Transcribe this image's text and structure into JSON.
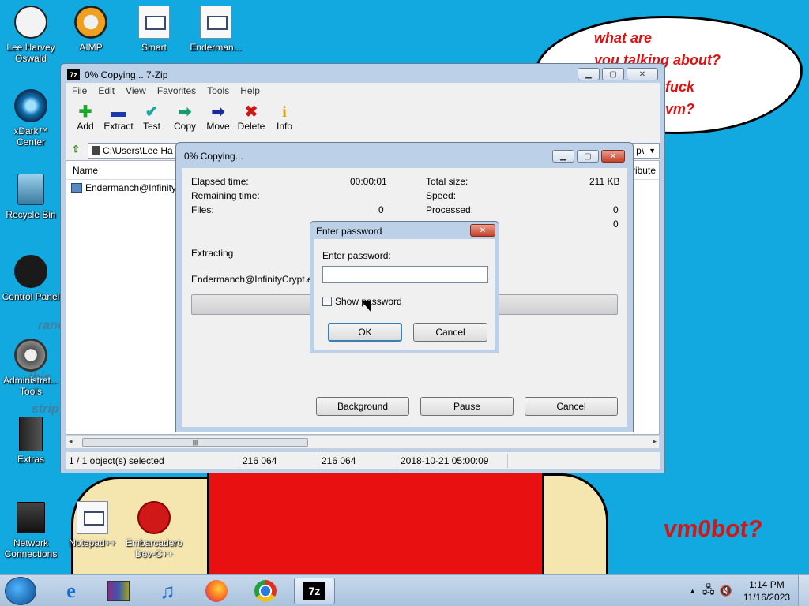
{
  "wallpaper": {
    "bubble_lines": [
      "what are",
      "you talking about?",
      "fuck",
      "vm?"
    ],
    "vm_label": "vm0bot?",
    "ghost_words": [
      "rand",
      "this",
      "strip"
    ]
  },
  "desktop_icons": [
    {
      "name": "lee-harvey-oswald",
      "label": "Lee Harvey Oswald"
    },
    {
      "name": "aimp",
      "label": "AIMP"
    },
    {
      "name": "smart",
      "label": "Smart"
    },
    {
      "name": "enderman",
      "label": "Enderman..."
    },
    {
      "name": "xdark-center",
      "label": "xDark™ Center"
    },
    {
      "name": "recycle-bin",
      "label": "Recycle Bin"
    },
    {
      "name": "control-panel",
      "label": "Control Panel"
    },
    {
      "name": "administrative-tools",
      "label": "Administrat... Tools"
    },
    {
      "name": "extras",
      "label": "Extras"
    },
    {
      "name": "network-connections",
      "label": "Network Connections"
    },
    {
      "name": "notepad-plus-plus",
      "label": "Notepad++"
    },
    {
      "name": "embarcadero-dev-cpp",
      "label": "Embarcadero Dev-C++"
    }
  ],
  "main_window": {
    "badge": "7z",
    "title": "0% Copying... 7-Zip",
    "menu": [
      "File",
      "Edit",
      "View",
      "Favorites",
      "Tools",
      "Help"
    ],
    "toolbar": [
      {
        "label": "Add",
        "glyph": "✚",
        "color": "#1aa82a"
      },
      {
        "label": "Extract",
        "glyph": "▬",
        "color": "#1a3aa8"
      },
      {
        "label": "Test",
        "glyph": "✔",
        "color": "#1aa8a0"
      },
      {
        "label": "Copy",
        "glyph": "➡",
        "color": "#1a9a70"
      },
      {
        "label": "Move",
        "glyph": "➡",
        "color": "#1a2a98"
      },
      {
        "label": "Delete",
        "glyph": "✖",
        "color": "#d01818"
      },
      {
        "label": "Info",
        "glyph": "i",
        "color": "#d0a800"
      }
    ],
    "address": "C:\\Users\\Lee Ha",
    "address_tail": "p\\",
    "list_header": "Name",
    "list_header_right": "tribute",
    "file_row": "Endermanch@Infinity",
    "status": {
      "selected": "1 / 1 object(s) selected",
      "size": "216 064",
      "packed": "216 064",
      "modified": "2018-10-21 05:00:09"
    }
  },
  "progress_window": {
    "title": "0% Copying...",
    "elapsed_label": "Elapsed time:",
    "elapsed_value": "00:00:01",
    "remaining_label": "Remaining time:",
    "files_label": "Files:",
    "files_value": "0",
    "total_size_label": "Total size:",
    "total_size_value": "211 KB",
    "speed_label": "Speed:",
    "processed_label": "Processed:",
    "processed_value": "0",
    "extra_value": "0",
    "operation": "Extracting",
    "current_file": "Endermanch@InfinityCrypt.exe",
    "buttons": {
      "background": "Background",
      "pause": "Pause",
      "cancel": "Cancel"
    }
  },
  "password_dialog": {
    "title": "Enter password",
    "prompt": "Enter password:",
    "input_value": "",
    "show_password": "Show password",
    "ok": "OK",
    "cancel": "Cancel"
  },
  "taskbar": {
    "apps": [
      "internet-explorer",
      "winrar",
      "itunes",
      "firefox",
      "chrome",
      "7zip"
    ],
    "active_app": "7zip",
    "clock_time": "1:14 PM",
    "clock_date": "11/16/2023"
  }
}
